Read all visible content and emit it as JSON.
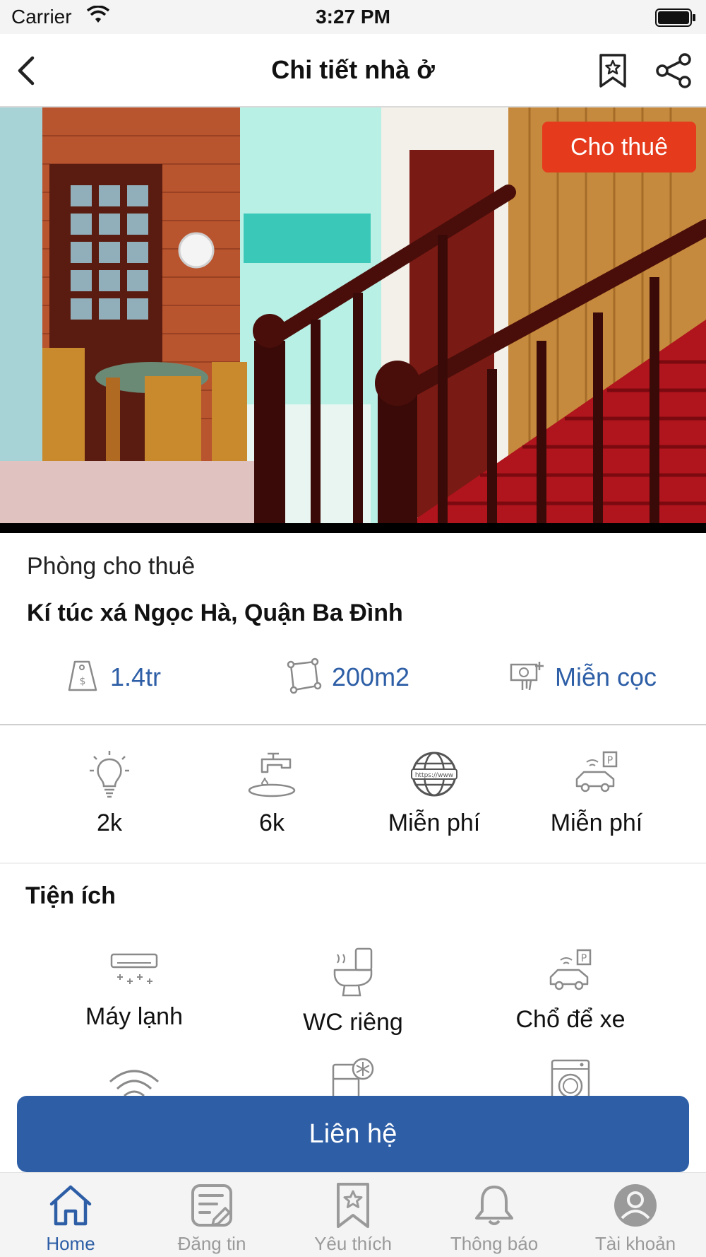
{
  "status_bar": {
    "carrier": "Carrier",
    "time": "3:27 PM"
  },
  "nav": {
    "title": "Chi tiết nhà ở",
    "back_icon": "chevron-left-icon",
    "bookmark_icon": "bookmark-star-icon",
    "share_icon": "share-icon"
  },
  "listing": {
    "badge": "Cho thuê",
    "type": "Phòng cho thuê",
    "address": "Kí túc xá Ngọc Hà, Quận Ba Đình",
    "price": "1.4tr",
    "area": "200m2",
    "deposit": "Miễn cọc"
  },
  "utilities": [
    {
      "icon": "lightbulb-icon",
      "value": "2k"
    },
    {
      "icon": "water-tap-icon",
      "value": "6k"
    },
    {
      "icon": "internet-globe-icon",
      "value": "Miễn phí"
    },
    {
      "icon": "parking-icon",
      "value": "Miễn phí"
    }
  ],
  "amenities": {
    "title": "Tiện ích",
    "items": [
      {
        "icon": "air-conditioner-icon",
        "label": "Máy lạnh"
      },
      {
        "icon": "toilet-icon",
        "label": "WC riêng"
      },
      {
        "icon": "parking-icon",
        "label": "Chổ để xe"
      },
      {
        "icon": "wifi-icon",
        "label": ""
      },
      {
        "icon": "fridge-icon",
        "label": ""
      },
      {
        "icon": "washing-machine-icon",
        "label": ""
      }
    ]
  },
  "contact_button": "Liên hệ",
  "tabs": [
    {
      "label": "Home",
      "icon": "home-icon",
      "active": true
    },
    {
      "label": "Đăng tin",
      "icon": "post-listing-icon",
      "active": false
    },
    {
      "label": "Yêu thích",
      "icon": "favorite-bookmark-icon",
      "active": false
    },
    {
      "label": "Thông báo",
      "icon": "bell-icon",
      "active": false
    },
    {
      "label": "Tài khoản",
      "icon": "account-icon",
      "active": false
    }
  ],
  "colors": {
    "accent": "#2d5ea6",
    "badge": "#e63a1c",
    "icon_gray": "#8a8a8a"
  }
}
